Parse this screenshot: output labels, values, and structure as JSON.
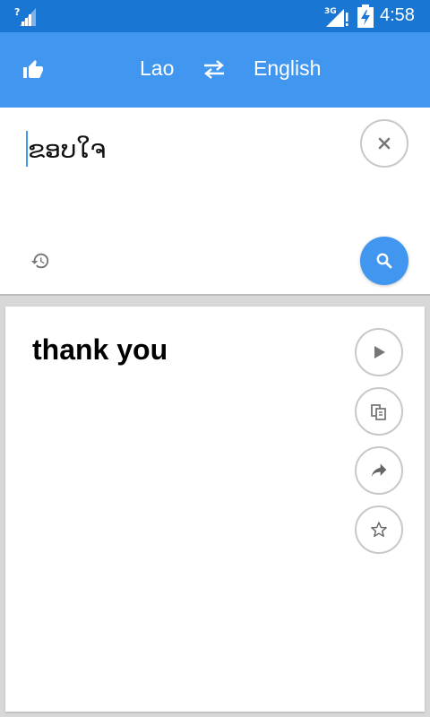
{
  "status_bar": {
    "left_signal_icon": "signal-unknown-icon",
    "network_type": "3G",
    "battery_icon": "battery-charging-icon",
    "time": "4:58"
  },
  "app_bar": {
    "like_icon": "thumbs-up-icon",
    "source_language": "Lao",
    "swap_icon": "swap-arrows-icon",
    "target_language": "English"
  },
  "input": {
    "text": "ຂອບໃຈ",
    "clear_icon": "close-icon",
    "history_icon": "history-icon",
    "search_icon": "search-icon"
  },
  "result": {
    "text": "thank you",
    "actions": [
      {
        "icon": "play-icon"
      },
      {
        "icon": "copy-icon"
      },
      {
        "icon": "share-icon"
      },
      {
        "icon": "star-icon"
      }
    ]
  },
  "colors": {
    "status_bar": "#1976d2",
    "app_bar": "#4196f0",
    "accent": "#4196f0"
  }
}
